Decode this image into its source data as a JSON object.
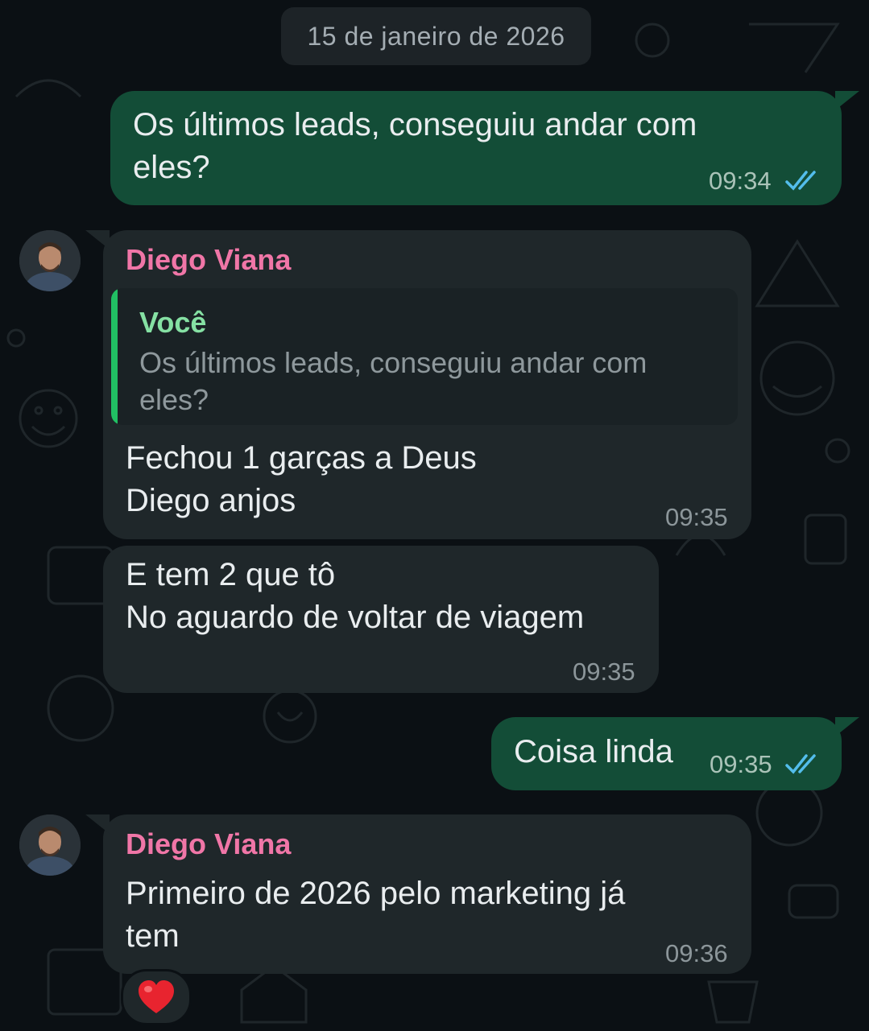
{
  "chat": {
    "date_chip": "15 de janeiro de 2026",
    "colors": {
      "background": "#0b1014",
      "outgoing_bubble": "#134d37",
      "incoming_bubble": "#1f272a",
      "sender_name": "#f076a7",
      "quote_bar": "#21c063",
      "read_ticks": "#53bdeb"
    },
    "messages": [
      {
        "direction": "out",
        "text": "Os últimos leads, conseguiu andar com\neles?",
        "time": "09:34",
        "status": "read"
      },
      {
        "direction": "in",
        "sender": "Diego Viana",
        "quote": {
          "author": "Você",
          "text": "Os últimos leads, conseguiu andar com eles?"
        },
        "text": "Fechou 1 garças a Deus\nDiego anjos",
        "time": "09:35"
      },
      {
        "direction": "in",
        "text": "E tem 2 que tô\nNo aguardo de voltar de viagem",
        "time": "09:35"
      },
      {
        "direction": "out",
        "text": "Coisa linda",
        "time": "09:35",
        "status": "read"
      },
      {
        "direction": "in",
        "sender": "Diego Viana",
        "text": "Primeiro de 2026 pelo marketing já\ntem",
        "time": "09:36",
        "reaction": "heart-emoji"
      }
    ]
  }
}
